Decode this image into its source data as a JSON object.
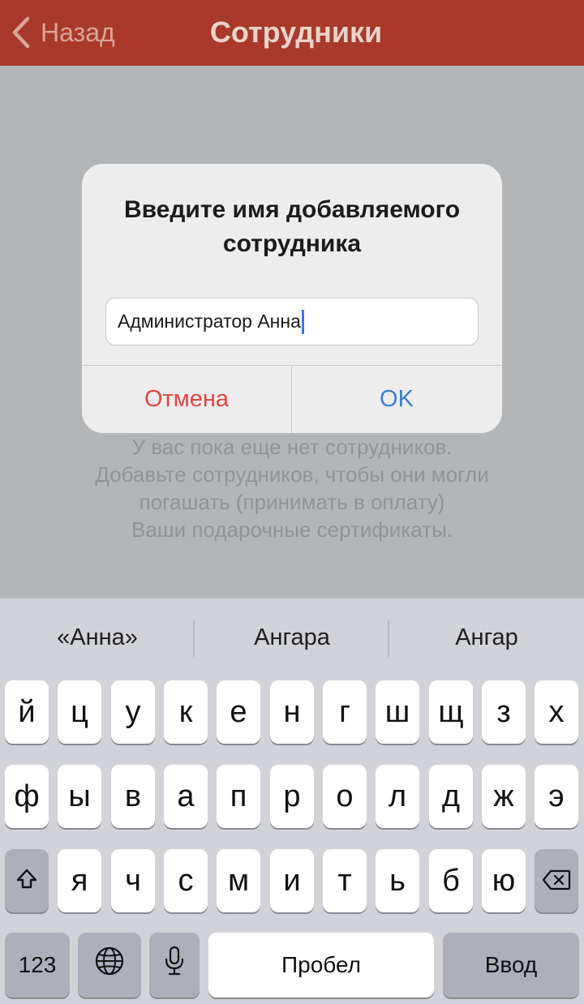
{
  "nav": {
    "back_label": "Назад",
    "title": "Сотрудники"
  },
  "empty_state": {
    "lines": [
      "У вас пока еще нет сотрудников.",
      "Добавьте сотрудников, чтобы они могли",
      "погашать (принимать в оплату)",
      "Ваши подарочные сертификаты."
    ]
  },
  "alert": {
    "title_line1": "Введите имя добавляемого",
    "title_line2": "сотрудника",
    "input_value": "Администратор Анна",
    "cancel_label": "Отмена",
    "ok_label": "OK"
  },
  "keyboard": {
    "suggestions": [
      "«Анна»",
      "Ангара",
      "Ангар"
    ],
    "row1": [
      "й",
      "ц",
      "у",
      "к",
      "е",
      "н",
      "г",
      "ш",
      "щ",
      "з",
      "х"
    ],
    "row2": [
      "ф",
      "ы",
      "в",
      "а",
      "п",
      "р",
      "о",
      "л",
      "д",
      "ж",
      "э"
    ],
    "row3": [
      "я",
      "ч",
      "с",
      "м",
      "и",
      "т",
      "ь",
      "б",
      "ю"
    ],
    "numbers_label": "123",
    "space_label": "Пробел",
    "return_label": "Ввод"
  },
  "colors": {
    "navbar": "#a93a29",
    "cancel": "#e0473c",
    "ok": "#3a7ed6"
  },
  "icons": [
    "chevron-left-icon",
    "shift-icon",
    "backspace-icon",
    "globe-icon",
    "microphone-icon"
  ]
}
